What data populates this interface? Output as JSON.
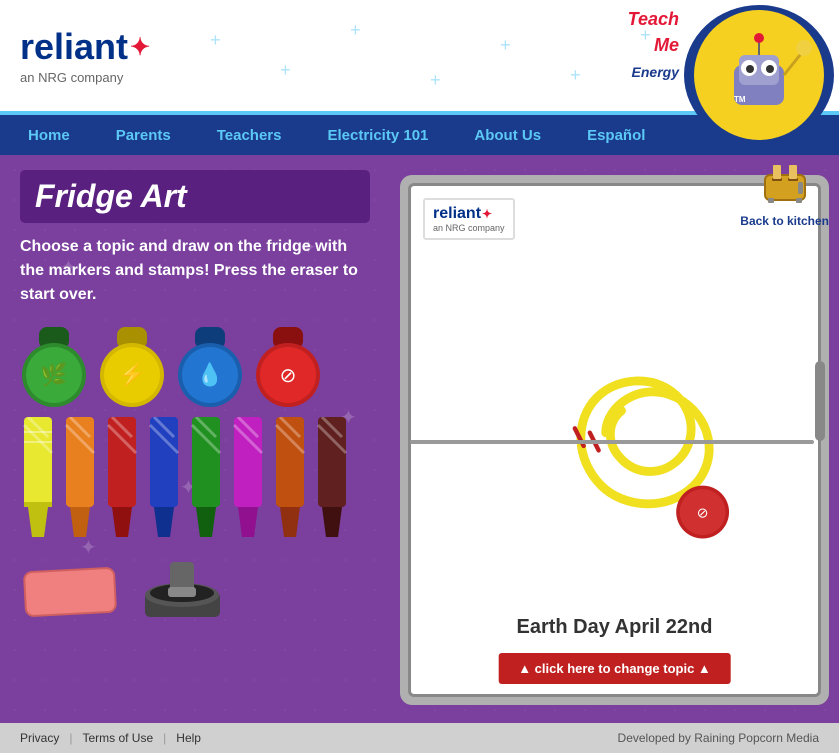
{
  "header": {
    "logo_text": "reliant",
    "logo_sub": "an NRG company",
    "mascot_label": "Teach Me",
    "mascot_sub": "Energy"
  },
  "nav": {
    "items": [
      {
        "label": "Home",
        "id": "home"
      },
      {
        "label": "Parents",
        "id": "parents"
      },
      {
        "label": "Teachers",
        "id": "teachers"
      },
      {
        "label": "Electricity 101",
        "id": "electricity101"
      },
      {
        "label": "About Us",
        "id": "aboutus"
      },
      {
        "label": "Español",
        "id": "espanol"
      }
    ]
  },
  "main": {
    "title": "Fridge Art",
    "description": "Choose a topic and draw on the fridge with the markers and stamps! Press the eraser to start over.",
    "back_to_kitchen": "Back to kitchen",
    "earth_day_label": "Earth Day April 22nd",
    "change_topic_label": "▲ click here to change topic ▲"
  },
  "footer": {
    "privacy": "Privacy",
    "separator1": "|",
    "terms": "Terms of Use",
    "separator2": "|",
    "help": "Help",
    "developed_by": "Developed by Raining Popcorn Media"
  },
  "stamps": [
    {
      "color": "green",
      "icon": "🌿"
    },
    {
      "color": "yellow",
      "icon": "⚡"
    },
    {
      "color": "blue",
      "icon": "💧"
    },
    {
      "color": "red",
      "icon": "⊘"
    }
  ],
  "markers": [
    {
      "class": "m1",
      "color": "yellow"
    },
    {
      "class": "m2",
      "color": "orange"
    },
    {
      "class": "m3",
      "color": "red"
    },
    {
      "class": "m4",
      "color": "blue"
    },
    {
      "class": "m5",
      "color": "green"
    },
    {
      "class": "m6",
      "color": "purple"
    },
    {
      "class": "m7",
      "color": "brown-orange"
    },
    {
      "class": "m8",
      "color": "dark-brown"
    }
  ]
}
